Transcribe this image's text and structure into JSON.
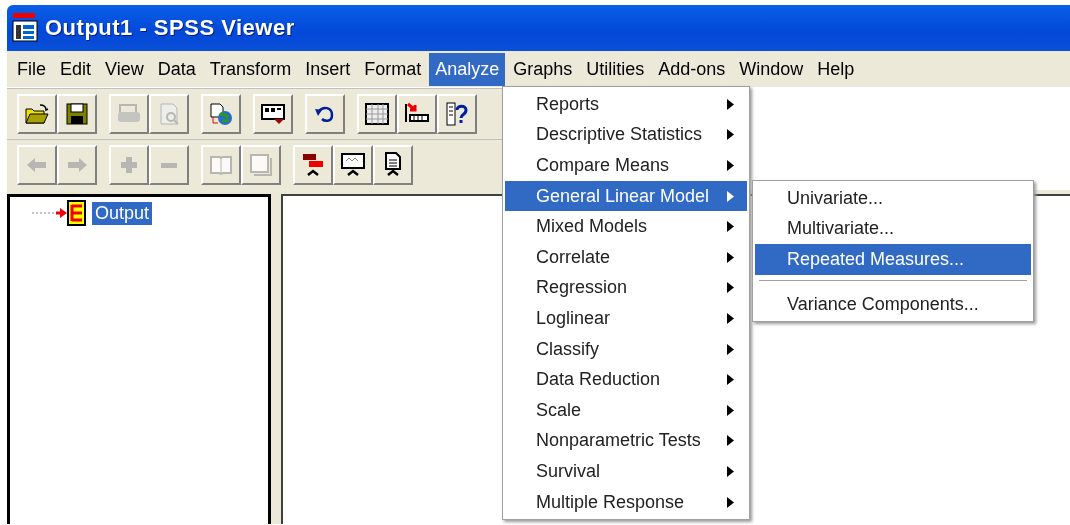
{
  "window": {
    "title": "Output1 - SPSS Viewer"
  },
  "menu_bar": [
    {
      "label": "File",
      "selected": false
    },
    {
      "label": "Edit",
      "selected": false
    },
    {
      "label": "View",
      "selected": false
    },
    {
      "label": "Data",
      "selected": false
    },
    {
      "label": "Transform",
      "selected": false
    },
    {
      "label": "Insert",
      "selected": false
    },
    {
      "label": "Format",
      "selected": false
    },
    {
      "label": "Analyze",
      "selected": true
    },
    {
      "label": "Graphs",
      "selected": false
    },
    {
      "label": "Utilities",
      "selected": false
    },
    {
      "label": "Add-ons",
      "selected": false
    },
    {
      "label": "Window",
      "selected": false
    },
    {
      "label": "Help",
      "selected": false
    }
  ],
  "toolbars": [
    {
      "buttons": [
        {
          "disabled": false
        },
        {
          "disabled": false
        },
        {
          "disabled": true
        },
        {
          "disabled": true
        },
        {
          "disabled": false
        },
        {
          "disabled": false
        },
        {
          "disabled": false
        },
        {
          "disabled": false
        },
        {
          "disabled": false
        },
        {
          "disabled": false
        }
      ]
    },
    {
      "buttons": [
        {
          "disabled": true
        },
        {
          "disabled": true
        },
        {
          "disabled": true
        },
        {
          "disabled": true
        },
        {
          "disabled": true
        },
        {
          "disabled": true
        },
        {
          "disabled": false
        },
        {
          "disabled": false
        },
        {
          "disabled": false
        }
      ]
    }
  ],
  "outline": {
    "items": [
      {
        "label": "Output",
        "selected": true
      }
    ]
  },
  "analyze_menu": [
    {
      "label": "Reports",
      "selected": false
    },
    {
      "label": "Descriptive Statistics",
      "selected": false
    },
    {
      "label": "Compare Means",
      "selected": false
    },
    {
      "label": "General Linear Model",
      "selected": true
    },
    {
      "label": "Mixed Models",
      "selected": false
    },
    {
      "label": "Correlate",
      "selected": false
    },
    {
      "label": "Regression",
      "selected": false
    },
    {
      "label": "Loglinear",
      "selected": false
    },
    {
      "label": "Classify",
      "selected": false
    },
    {
      "label": "Data Reduction",
      "selected": false
    },
    {
      "label": "Scale",
      "selected": false
    },
    {
      "label": "Nonparametric Tests",
      "selected": false
    },
    {
      "label": "Survival",
      "selected": false
    },
    {
      "label": "Multiple Response",
      "selected": false
    }
  ],
  "submenu": [
    {
      "kind": "item",
      "label": "Univariate...",
      "selected": false
    },
    {
      "kind": "item",
      "label": "Multivariate...",
      "selected": false
    },
    {
      "kind": "item",
      "label": "Repeated Measures...",
      "selected": true
    },
    {
      "kind": "separator"
    },
    {
      "kind": "item",
      "label": "Variance Components...",
      "selected": false
    }
  ]
}
